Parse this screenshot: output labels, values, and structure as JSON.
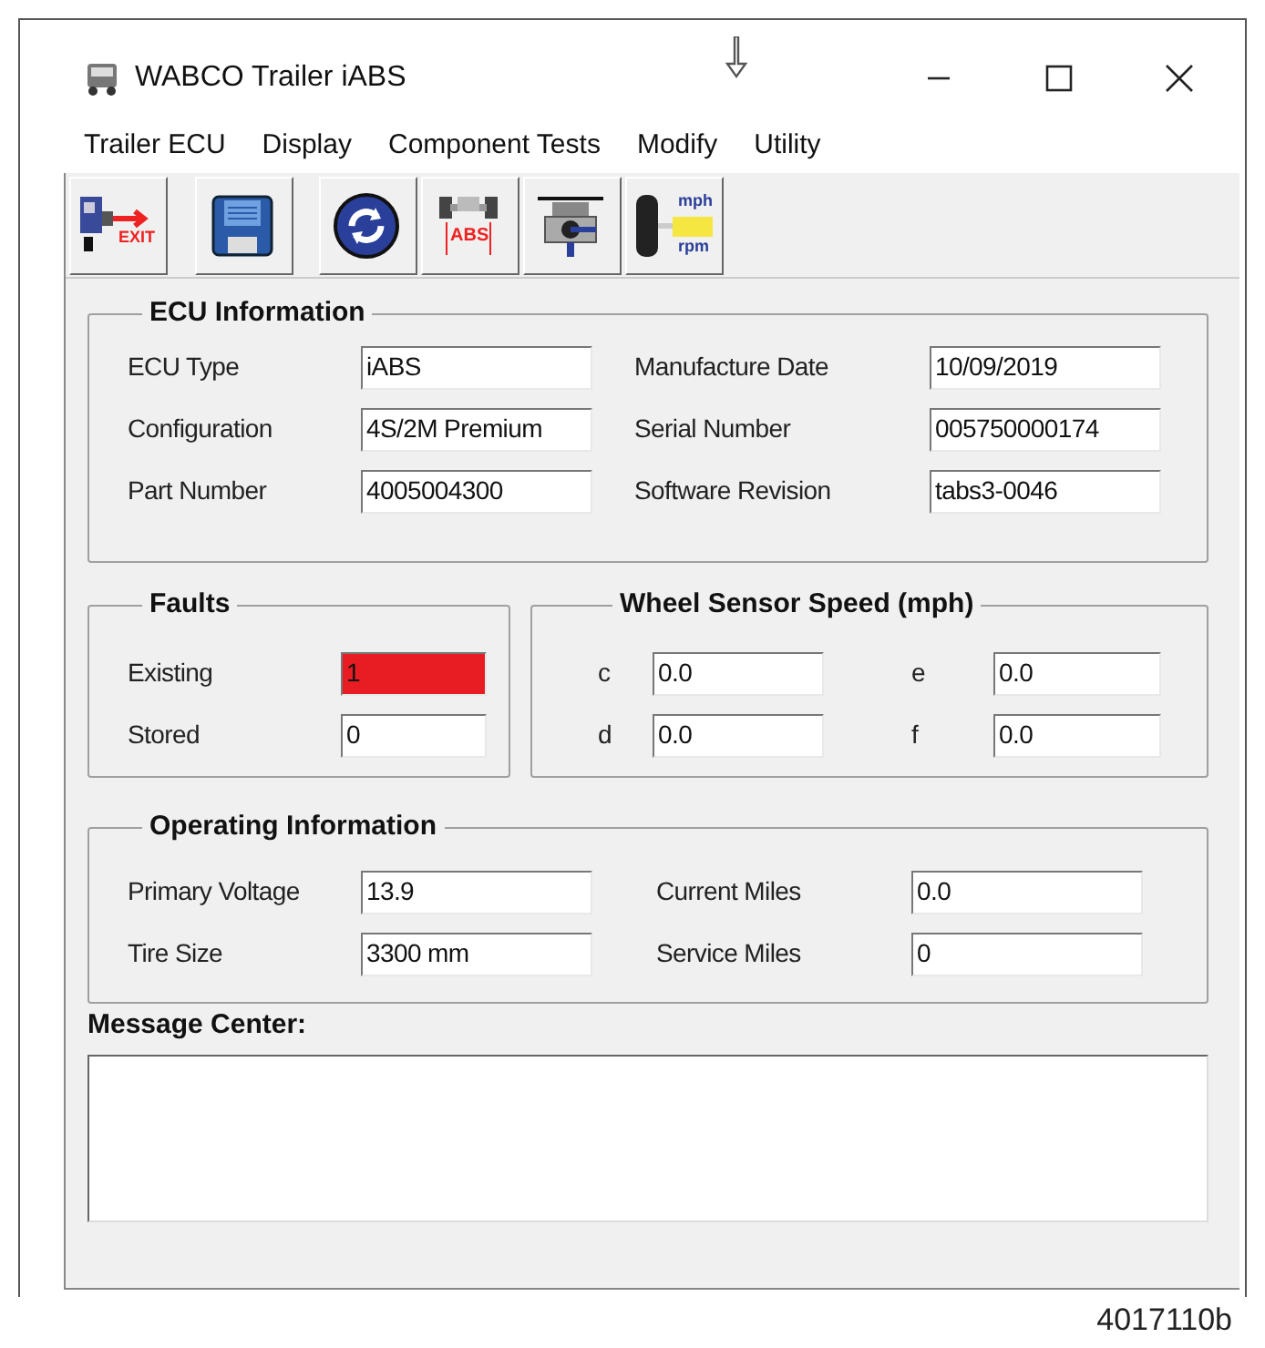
{
  "window": {
    "title": "WABCO Trailer iABS"
  },
  "menu": [
    "Trailer ECU",
    "Display",
    "Component Tests",
    "Modify",
    "Utility"
  ],
  "toolbar": [
    {
      "kind": "exit",
      "texts": [
        "EXIT"
      ]
    },
    {
      "kind": "save"
    },
    {
      "kind": "refresh"
    },
    {
      "kind": "abs",
      "texts": [
        "ABS"
      ]
    },
    {
      "kind": "valve"
    },
    {
      "kind": "speed",
      "texts": [
        "mph",
        "rpm"
      ]
    }
  ],
  "ecu_information": {
    "title": "ECU Information",
    "fields": [
      {
        "label": "ECU Type",
        "value": "iABS"
      },
      {
        "label": "Manufacture Date",
        "value": "10/09/2019"
      },
      {
        "label": "Configuration",
        "value": "4S/2M Premium"
      },
      {
        "label": "Serial Number",
        "value": "005750000174"
      },
      {
        "label": "Part Number",
        "value": "4005004300"
      },
      {
        "label": "Software Revision",
        "value": "tabs3-0046"
      }
    ]
  },
  "faults": {
    "title": "Faults",
    "fields": [
      {
        "label": "Existing",
        "value": "1",
        "alert": true
      },
      {
        "label": "Stored",
        "value": "0",
        "alert": false
      }
    ]
  },
  "wheel_sensor_speed": {
    "title": "Wheel Sensor Speed (mph)",
    "fields": [
      {
        "label": "c",
        "value": "0.0"
      },
      {
        "label": "e",
        "value": "0.0"
      },
      {
        "label": "d",
        "value": "0.0"
      },
      {
        "label": "f",
        "value": "0.0"
      }
    ]
  },
  "operating_information": {
    "title": "Operating Information",
    "fields": [
      {
        "label": "Primary Voltage",
        "value": "13.9"
      },
      {
        "label": "Current Miles",
        "value": "0.0"
      },
      {
        "label": "Tire Size",
        "value": "3300 mm"
      },
      {
        "label": "Service Miles",
        "value": "0"
      }
    ]
  },
  "message_center": {
    "label": "Message Center:"
  },
  "figure_id": "4017110b"
}
